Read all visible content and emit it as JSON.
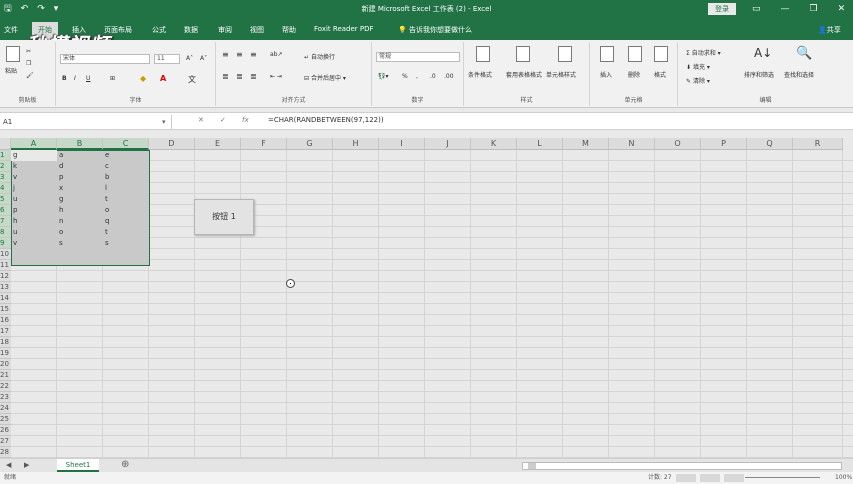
{
  "titlebar": {
    "qat": [
      "🖫",
      "↶",
      "↷",
      "▾"
    ],
    "title": "新建 Microsoft Excel 工作表 (2) - Excel",
    "login": "登录",
    "win_controls": [
      "▭",
      "—",
      "❐",
      "✕"
    ]
  },
  "tabs": {
    "items": [
      "文件",
      "开始",
      "插入",
      "页面布局",
      "公式",
      "数据",
      "审阅",
      "视图",
      "帮助",
      "Foxit Reader PDF"
    ],
    "tell_me": "告诉我你想要做什么",
    "share": "共享"
  },
  "watermark": "秒懂视频",
  "ribbon": {
    "paste": "粘贴",
    "clipboard": "剪贴板",
    "font_name": "宋体",
    "font_size": "11",
    "font": "字体",
    "wrap": "自动换行",
    "merge": "合并后居中",
    "alignment": "对齐方式",
    "number_format": "常规",
    "number": "数字",
    "cond_format": "条件格式",
    "as_table": "套用表格格式",
    "cell_styles": "单元格样式",
    "styles": "样式",
    "insert": "插入",
    "delete": "删除",
    "format": "格式",
    "cells": "单元格",
    "autosum": "自动求和",
    "fill": "填充",
    "clear": "清除",
    "sort_filter": "排序和筛选",
    "find_select": "查找和选择",
    "editing": "编辑"
  },
  "formula_bar": {
    "name_box": "A1",
    "cancel": "✕",
    "confirm": "✓",
    "fx": "fx",
    "formula": "=CHAR(RANDBETWEEN(97,122))"
  },
  "grid": {
    "columns": [
      "A",
      "B",
      "C",
      "D",
      "E",
      "F",
      "G",
      "H",
      "I",
      "J",
      "K",
      "L",
      "M",
      "N",
      "O",
      "P",
      "Q",
      "R"
    ],
    "rows": [
      "1",
      "2",
      "3",
      "4",
      "5",
      "6",
      "7",
      "8",
      "9",
      "10",
      "11",
      "12",
      "13",
      "14",
      "15",
      "16",
      "17",
      "18",
      "19",
      "20",
      "21",
      "22",
      "23",
      "24",
      "25",
      "26",
      "27",
      "28"
    ],
    "data": [
      [
        "g",
        "a",
        "e"
      ],
      [
        "k",
        "d",
        "c"
      ],
      [
        "v",
        "p",
        "b"
      ],
      [
        "j",
        "x",
        "l"
      ],
      [
        "u",
        "g",
        "t"
      ],
      [
        "p",
        "h",
        "o"
      ],
      [
        "h",
        "n",
        "q"
      ],
      [
        "u",
        "o",
        "t"
      ],
      [
        "v",
        "s",
        "s"
      ]
    ],
    "button_label": "按钮 1"
  },
  "sheets": {
    "nav_prev": "◀",
    "nav_next": "▶",
    "active": "Sheet1",
    "add": "⊕"
  },
  "status": {
    "ready": "就绪",
    "count": "计数: 27",
    "zoom": "100%"
  }
}
